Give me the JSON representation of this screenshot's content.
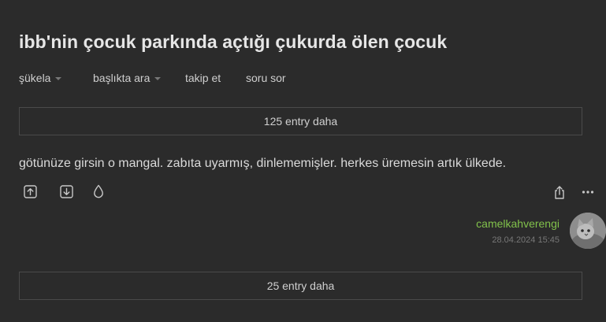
{
  "topic": {
    "title": "ibb'nin çocuk parkında açtığı çukurda ölen çocuk"
  },
  "subnav": {
    "sukela_label": "şükela",
    "search_label": "başlıkta ara",
    "follow_label": "takip et",
    "ask_label": "soru sor"
  },
  "more_top": {
    "label": "125 entry daha"
  },
  "entry": {
    "text": "götünüze girsin o mangal. zabıta uyarmış, dinlememişler. herkes üremesin artık ülkede.",
    "author": "camelkahverengi",
    "date": "28.04.2024 15:45",
    "icons": [
      "upvote-icon",
      "downvote-icon",
      "favorite-drop-icon",
      "share-icon",
      "more-options-icon"
    ]
  },
  "more_bottom": {
    "label": "25 entry daha"
  },
  "colors": {
    "background": "#2b2b2b",
    "text": "#d7d7d7",
    "author": "#81c14b",
    "muted": "#777777",
    "border": "#4a4a4a"
  }
}
